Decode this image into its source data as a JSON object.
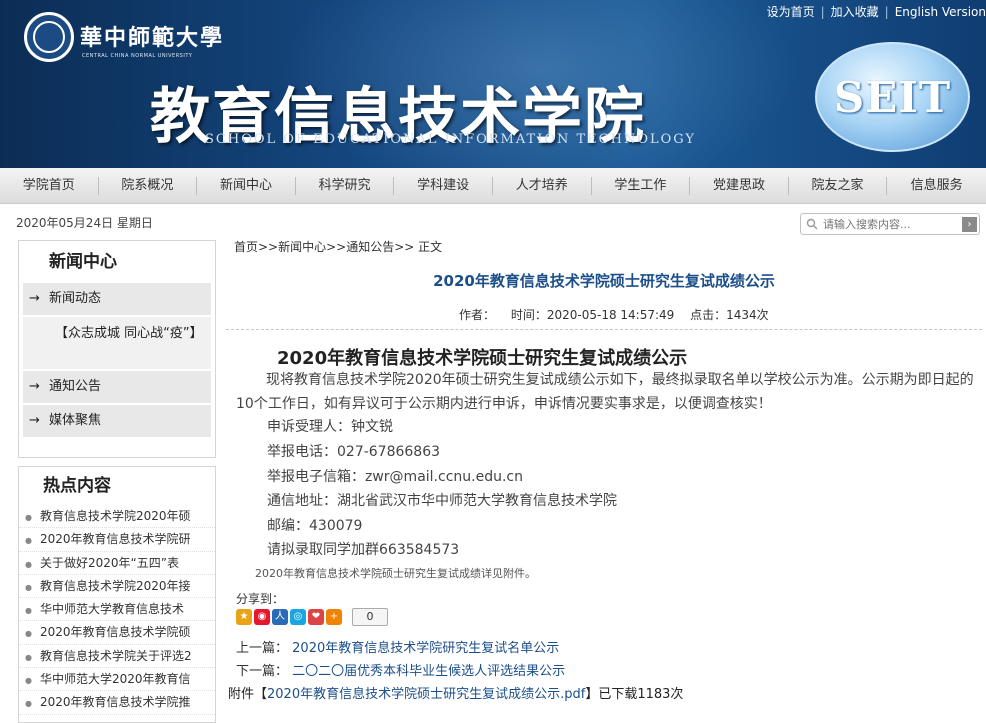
{
  "top_links": [
    "设为首页",
    "加入收藏",
    "English Version"
  ],
  "header": {
    "university_name": "華中師範大學",
    "university_en": "CENTRAL CHINA NORMAL UNIVERSITY",
    "school_name": "教育信息技术学院",
    "school_en": "SCHOOL OF EDUCATIONAL INFORMATION TECHNOLOGY",
    "badge": "SEIT"
  },
  "nav": [
    "学院首页",
    "院系概况",
    "新闻中心",
    "科学研究",
    "学科建设",
    "人才培养",
    "学生工作",
    "党建思政",
    "院友之家",
    "信息服务"
  ],
  "date": "2020年05月24日 星期日",
  "search": {
    "placeholder": "请输入搜索内容..."
  },
  "sidebar": {
    "title": "新闻中心",
    "items": [
      "新闻动态",
      "【众志成城 同心战“疫”】",
      "通知公告",
      "媒体聚焦"
    ]
  },
  "hot": {
    "title": "热点内容",
    "items": [
      "教育信息技术学院2020年硕",
      "2020年教育信息技术学院研",
      "关于做好2020年“五四”表",
      "教育信息技术学院2020年接",
      "华中师范大学教育信息技术",
      "2020年教育信息技术学院硕",
      "教育信息技术学院关于评选2",
      "华中师范大学2020年教育信",
      "2020年教育信息技术学院推"
    ]
  },
  "breadcrumb": "首页>>新闻中心>>通知公告>> 正文",
  "article": {
    "title": "2020年教育信息技术学院硕士研究生复试成绩公示",
    "author": "作者：",
    "time": "时间：2020-05-18 14:57:49",
    "views": "点击：1434次",
    "body_title": "2020年教育信息技术学院硕士研究生复试成绩公示",
    "paragraph": "现将教育信息技术学院2020年硕士研究生复试成绩公示如下，最终拟录取名单以学校公示为准。公示期为即日起的10个工作日，如有异议可于公示期内进行申诉，申诉情况要实事求是，以便调查核实！",
    "lines": [
      "申诉受理人：钟文锐",
      "举报电话：027-67866863",
      "举报电子信箱：zwr@mail.ccnu.edu.cn",
      "通信地址：湖北省武汉市华中师范大学教育信息技术学院",
      "邮编：430079",
      "请拟录取同学加群663584573"
    ],
    "attach_note": "2020年教育信息技术学院硕士研究生复试成绩详见附件。",
    "share_label": "分享到：",
    "share_count": "0",
    "prev_label": "上一篇：",
    "prev_title": "2020年教育信息技术学院研究生复试名单公示",
    "next_label": "下一篇：",
    "next_title": "二〇二〇届优秀本科毕业生候选人评选结果公示",
    "attach_prefix": "附件【",
    "attach_file": "2020年教育信息技术学院硕士研究生复试成绩公示.pdf",
    "attach_suffix": "】已下载1183次"
  },
  "colors": {
    "banner": "#14467e",
    "link": "#1c4f8a"
  }
}
